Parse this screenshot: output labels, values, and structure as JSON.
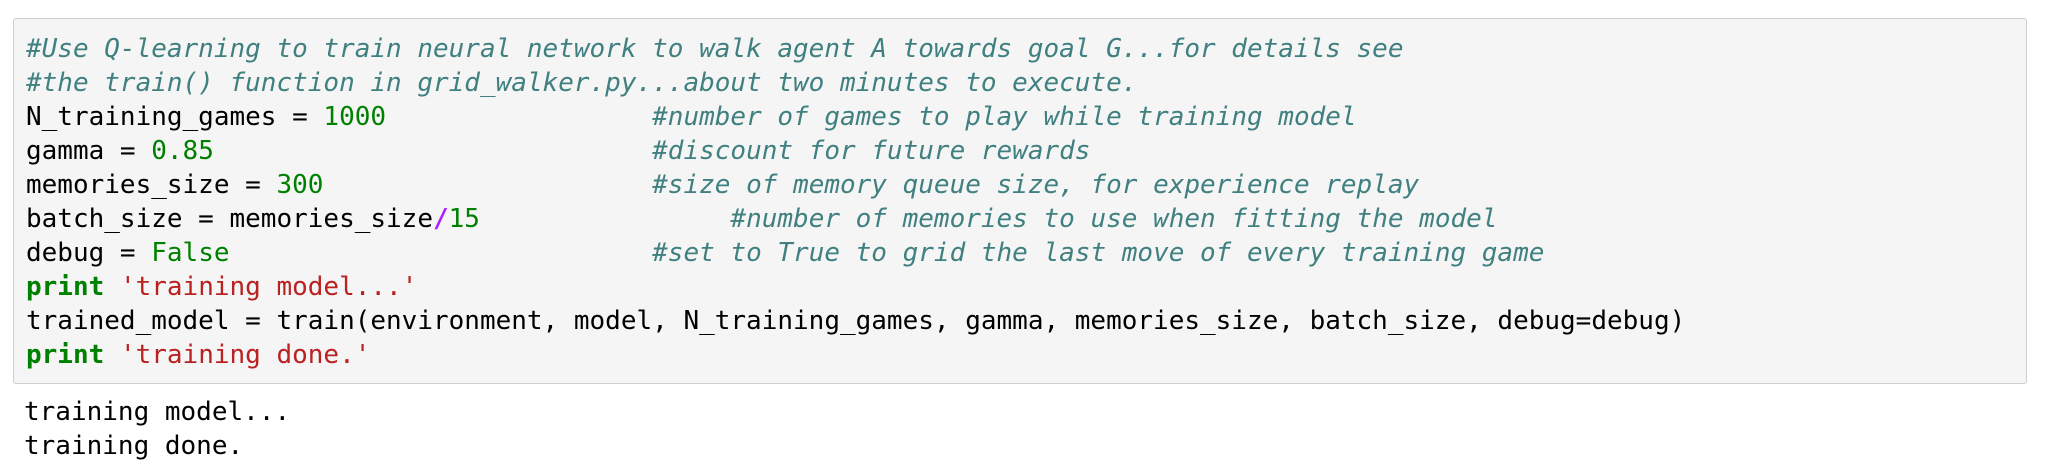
{
  "input_cell": {
    "lines": [
      {
        "comment": "#Use Q-learning to train neural network to walk agent A towards goal G...for details see"
      },
      {
        "comment": "#the train() function in grid_walker.py...about two minutes to execute."
      },
      {
        "code": "N_training_games = ",
        "value": "1000",
        "pad": "                 ",
        "comment": "#number of games to play while training model"
      },
      {
        "code": "gamma = ",
        "value": "0.85",
        "pad": "                            ",
        "comment": "#discount for future rewards"
      },
      {
        "code": "memories_size = ",
        "value": "300",
        "pad": "                     ",
        "comment": "#size of memory queue size, for experience replay"
      },
      {
        "code": "batch_size = memories_size",
        "operator": "/",
        "value": "15",
        "pad": "                ",
        "comment": "#number of memories to use when fitting the model"
      },
      {
        "code": "debug = ",
        "value": "False",
        "pad": "                           ",
        "comment": "#set to True to grid the last move of every training game"
      },
      {
        "keyword": "print",
        "space": " ",
        "string": "'training model...'"
      },
      {
        "code": "trained_model = train(environment, model, N_training_games, gamma, memories_size, batch_size, debug=debug)"
      },
      {
        "keyword": "print",
        "space": " ",
        "string": "'training done.'"
      }
    ]
  },
  "output_cell": {
    "lines": [
      "training model...",
      "training done."
    ]
  },
  "colors": {
    "comment": "#408080",
    "number": "#008000",
    "keyword": "#008000",
    "string": "#ba2121",
    "operator": "#aa22ff",
    "cell_background": "#f5f5f5",
    "cell_border": "#cfcfcf"
  }
}
